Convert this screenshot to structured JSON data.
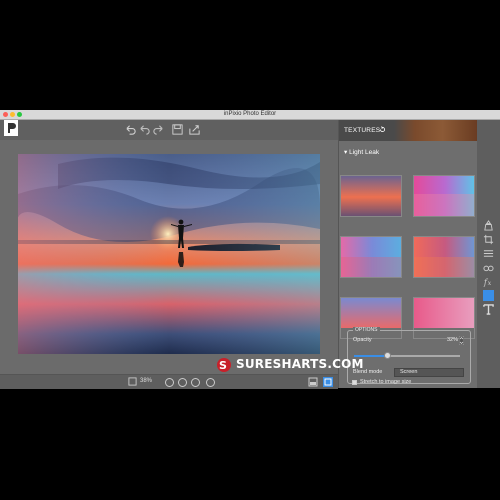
{
  "window": {
    "title": "inPixio Photo Editor"
  },
  "colors": {
    "close": "#fc5f57",
    "minimize": "#fdbc2e",
    "maximize": "#28c840",
    "accent": "#3a8ee6"
  },
  "toolbar": {
    "icons": [
      "undo-icon",
      "undo-step-icon",
      "redo-icon",
      "save-icon",
      "share-icon"
    ]
  },
  "status": {
    "zoom": "38%"
  },
  "panel": {
    "header": "TEXTURES",
    "category": "Light Leak",
    "thumbnails": 6
  },
  "options": {
    "legend": "OPTIONS",
    "opacity_label": "Opacity",
    "opacity_value": "32%",
    "opacity_fraction": 0.32,
    "blend_label": "Blend mode",
    "blend_value": "Screen",
    "stretch_label": "Stretch to image size"
  },
  "sidebar": {
    "icons": [
      "cutout-icon",
      "crop-icon",
      "adjust-icon",
      "glasses-icon",
      "fx-icon",
      "texture-icon",
      "text-icon"
    ]
  },
  "watermark": {
    "text": "SURESHARTS.COM"
  }
}
